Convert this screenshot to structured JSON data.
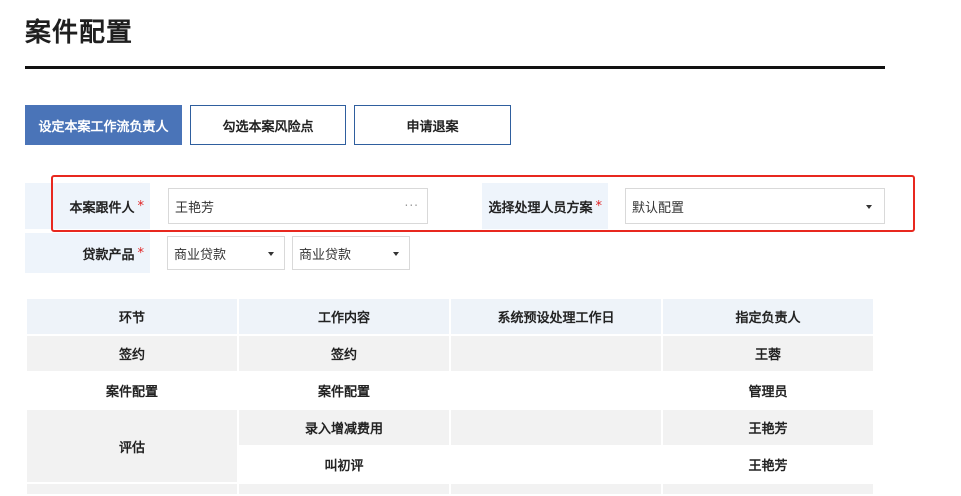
{
  "page": {
    "title": "案件配置"
  },
  "tabs": [
    {
      "label": "设定本案工作流负责人",
      "active": true
    },
    {
      "label": "勾选本案风险点",
      "active": false
    },
    {
      "label": "申请退案",
      "active": false
    }
  ],
  "form": {
    "handler": {
      "label": "本案跟件人",
      "required_mark": "*",
      "value": "王艳芳"
    },
    "scheme": {
      "label": "选择处理人员方案",
      "required_mark": "*",
      "value": "默认配置"
    },
    "product": {
      "label": "贷款产品",
      "required_mark": "*",
      "value1": "商业贷款",
      "value2": "商业贷款"
    }
  },
  "table": {
    "headers": [
      "环节",
      "工作内容",
      "系统预设处理工作日",
      "指定负责人"
    ],
    "rows": [
      {
        "stage": "签约",
        "content": "签约",
        "days": "",
        "owner": "王蓉"
      },
      {
        "stage": "案件配置",
        "content": "案件配置",
        "days": "",
        "owner": "管理员"
      },
      {
        "stage": "评估",
        "content": "录入增减费用",
        "days": "",
        "owner": "王艳芳"
      },
      {
        "stage": "",
        "content": "叫初评",
        "days": "",
        "owner": "王艳芳"
      }
    ]
  },
  "colors": {
    "accent": "#4a74b8",
    "highlight": "#e8281f",
    "label_bg": "#eef4fb",
    "required": "#e02020"
  }
}
